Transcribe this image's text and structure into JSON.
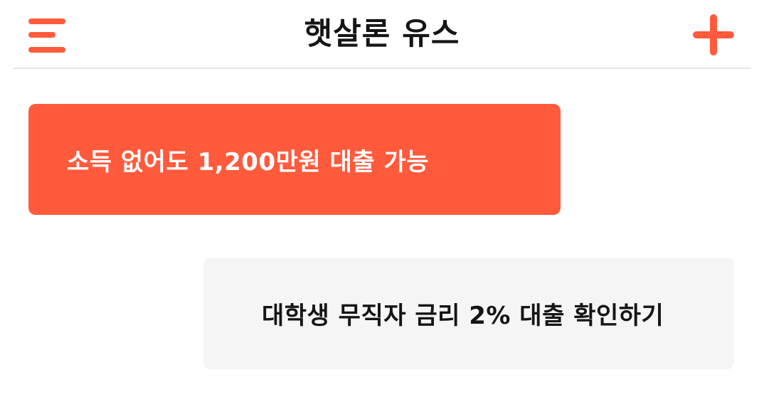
{
  "header": {
    "title": "햇살론 유스",
    "menu_icon": "hamburger-menu-icon",
    "add_icon": "plus-icon"
  },
  "cards": [
    {
      "label": "소득 없어도 1,200만원 대출 가능"
    },
    {
      "label": "대학생 무직자 금리 2% 대출 확인하기"
    }
  ],
  "colors": {
    "accent": "#ff5a3c",
    "text": "#151515",
    "secondary_card_bg": "#f5f5f5",
    "divider": "#e6e6e6"
  }
}
